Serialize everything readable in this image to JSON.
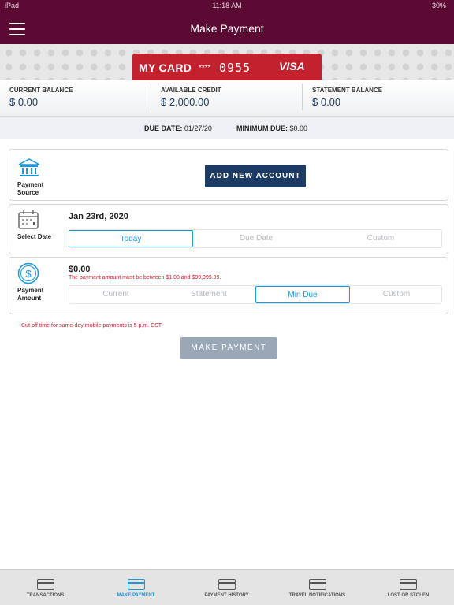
{
  "status_bar": {
    "carrier": "iPad",
    "time": "11:18 AM",
    "battery": "30%"
  },
  "header": {
    "title": "Make Payment"
  },
  "card": {
    "name": "MY CARD",
    "mask": "****",
    "last4": "0955",
    "network": "VISA"
  },
  "balances": [
    {
      "label": "CURRENT BALANCE",
      "value": "$ 0.00"
    },
    {
      "label": "AVAILABLE CREDIT",
      "value": "$ 2,000.00"
    },
    {
      "label": "STATEMENT BALANCE",
      "value": "$ 0.00"
    }
  ],
  "due": {
    "due_date_label": "DUE DATE:",
    "due_date": "01/27/20",
    "min_due_label": "MINIMUM DUE:",
    "min_due": "$0.00"
  },
  "payment_source": {
    "label_line1": "Payment",
    "label_line2": "Source",
    "button": "ADD NEW ACCOUNT"
  },
  "select_date": {
    "label": "Select Date",
    "value": "Jan 23rd, 2020",
    "options": [
      "Today",
      "Due Date",
      "Custom"
    ],
    "selected": "Today"
  },
  "payment_amount": {
    "label_line1": "Payment",
    "label_line2": "Amount",
    "value": "$0.00",
    "error": "The payment amount must be between $1.00 and $99,999.99.",
    "options": [
      "Current",
      "Statement",
      "Min Due",
      "Custom"
    ],
    "selected": "Min Due"
  },
  "cutoff_note": "Cut-off time for same-day mobile payments is 5 p.m. CST",
  "make_payment_button": "MAKE PAYMENT",
  "tabs": [
    {
      "label": "TRANSACTIONS",
      "icon": "card-icon"
    },
    {
      "label": "MAKE PAYMENT",
      "icon": "card-icon",
      "active": true
    },
    {
      "label": "PAYMENT HISTORY",
      "icon": "calendar-icon"
    },
    {
      "label": "TRAVEL NOTIFICATIONS",
      "icon": "card-plane-icon"
    },
    {
      "label": "LOST OR STOLEN",
      "icon": "card-alert-icon"
    }
  ],
  "colors": {
    "header": "#5a0a33",
    "card": "#c4212e",
    "accent": "#1c98d6",
    "primary_button": "#1b3a64",
    "disabled_button": "#9aa7b7",
    "error": "#c4212e"
  }
}
